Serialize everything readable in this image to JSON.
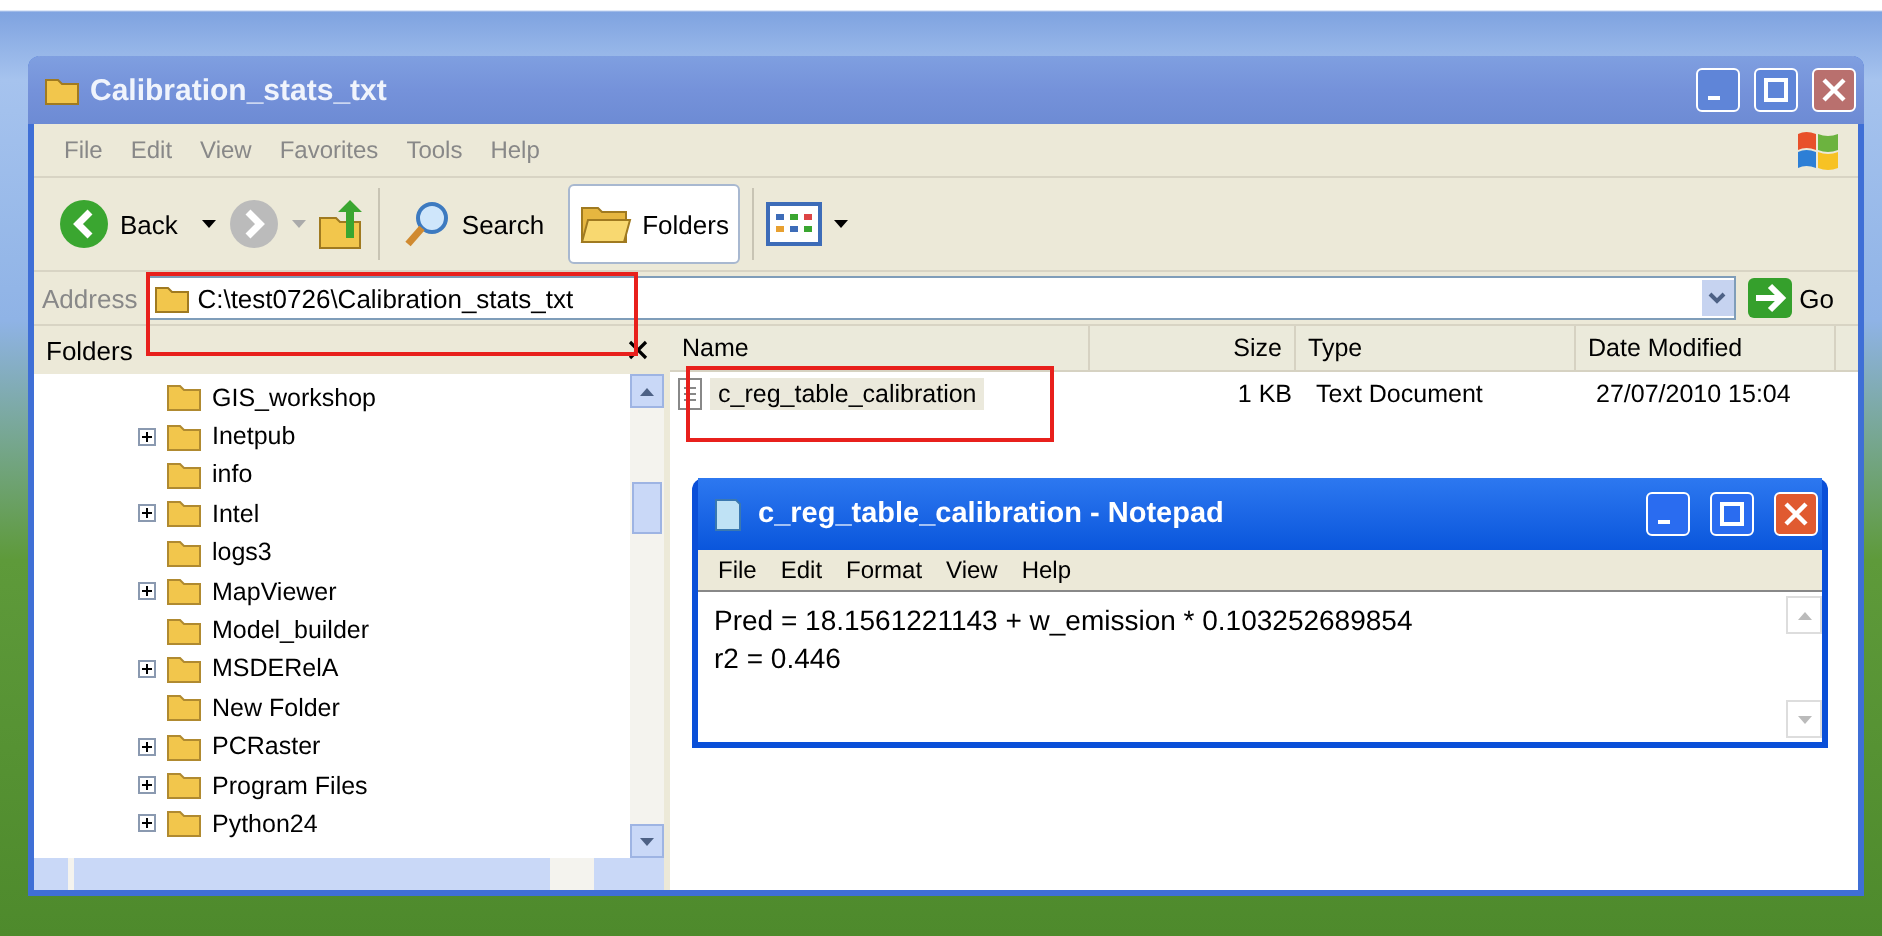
{
  "window": {
    "title": "Calibration_stats_txt"
  },
  "menu": [
    "File",
    "Edit",
    "View",
    "Favorites",
    "Tools",
    "Help"
  ],
  "toolbar": {
    "back": "Back",
    "search": "Search",
    "folders": {
      "label": "Folders",
      "selected": true
    }
  },
  "address": {
    "label": "Address",
    "value": "C:\\test0726\\Calibration_stats_txt",
    "go": "Go"
  },
  "folders_pane": {
    "title": "Folders",
    "items": [
      {
        "name": "GIS_workshop",
        "expandable": false
      },
      {
        "name": "Inetpub",
        "expandable": true
      },
      {
        "name": "info",
        "expandable": false
      },
      {
        "name": "Intel",
        "expandable": true
      },
      {
        "name": "logs3",
        "expandable": false
      },
      {
        "name": "MapViewer",
        "expandable": true
      },
      {
        "name": "Model_builder",
        "expandable": false
      },
      {
        "name": "MSDERelA",
        "expandable": true
      },
      {
        "name": "New Folder",
        "expandable": false
      },
      {
        "name": "PCRaster",
        "expandable": true
      },
      {
        "name": "Program Files",
        "expandable": true
      },
      {
        "name": "Python24",
        "expandable": true
      }
    ]
  },
  "file_list": {
    "columns": [
      "Name",
      "Size",
      "Type",
      "Date Modified"
    ],
    "rows": [
      {
        "name": "c_reg_table_calibration",
        "size": "1 KB",
        "type": "Text Document",
        "modified": "27/07/2010 15:04",
        "selected": true
      }
    ]
  },
  "notepad": {
    "title": "c_reg_table_calibration - Notepad",
    "menu": [
      "File",
      "Edit",
      "Format",
      "View",
      "Help"
    ],
    "lines": [
      "Pred = 18.1561221143 + w_emission * 0.103252689854",
      "r2 = 0.446"
    ]
  }
}
